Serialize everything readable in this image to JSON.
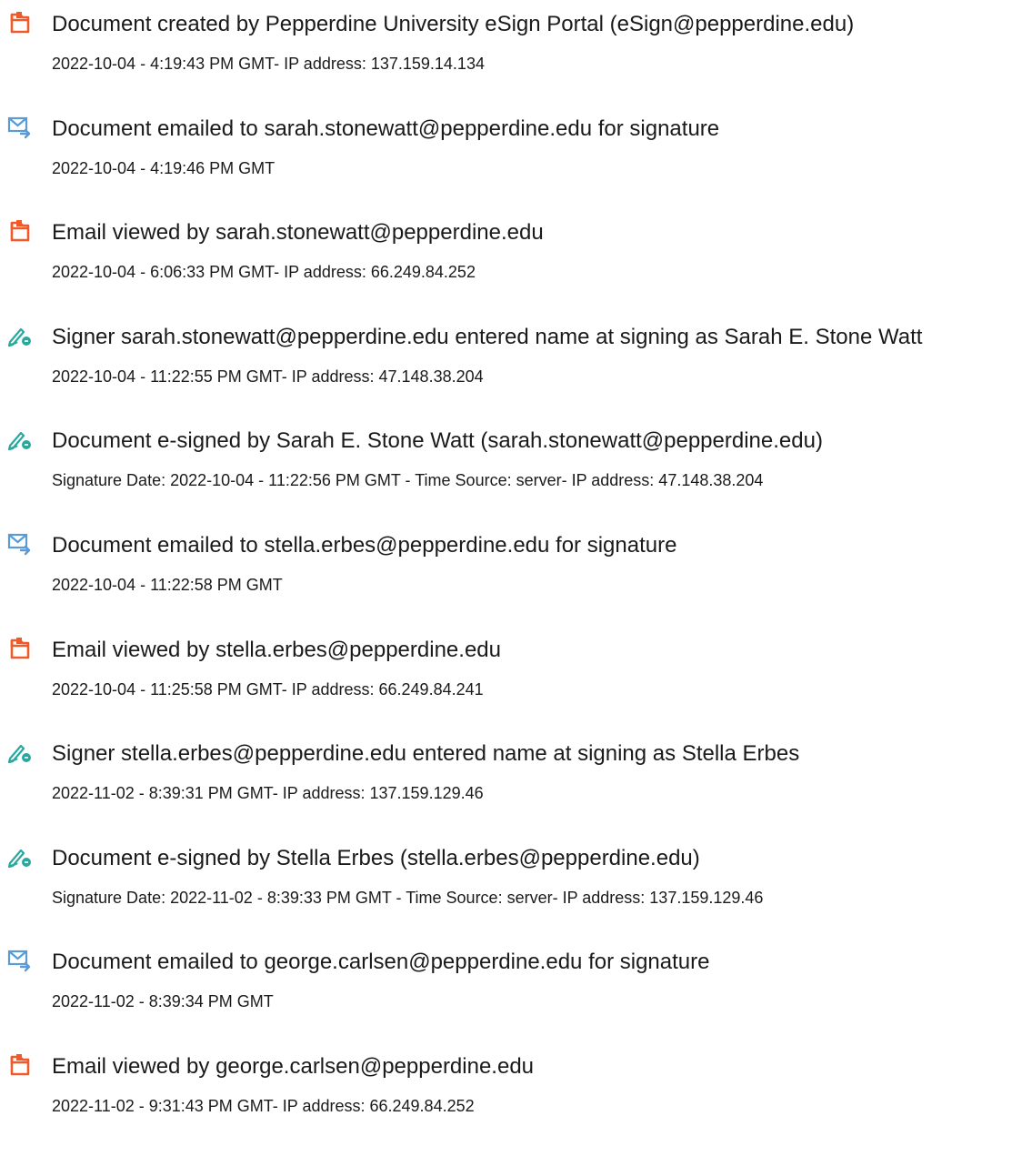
{
  "colors": {
    "created_icon": "#f05a28",
    "email_icon": "#5b9bd5",
    "sign_icon": "#2aa8a0"
  },
  "events": [
    {
      "icon": "document-created-icon",
      "title": "Document created by Pepperdine University eSign Portal (eSign@pepperdine.edu)",
      "meta": "2022-10-04 - 4:19:43 PM GMT- IP address: 137.159.14.134"
    },
    {
      "icon": "email-sent-icon",
      "title": "Document emailed to sarah.stonewatt@pepperdine.edu for signature",
      "meta": "2022-10-04 - 4:19:46 PM GMT"
    },
    {
      "icon": "document-viewed-icon",
      "title": "Email viewed by sarah.stonewatt@pepperdine.edu",
      "meta": "2022-10-04 - 6:06:33 PM GMT- IP address: 66.249.84.252"
    },
    {
      "icon": "esign-pen-icon",
      "title": "Signer sarah.stonewatt@pepperdine.edu entered name at signing as Sarah E. Stone Watt",
      "meta": "2022-10-04 - 11:22:55 PM GMT- IP address: 47.148.38.204"
    },
    {
      "icon": "esign-pen-icon",
      "title": "Document e-signed by Sarah E. Stone Watt (sarah.stonewatt@pepperdine.edu)",
      "meta": "Signature Date: 2022-10-04 - 11:22:56 PM GMT - Time Source: server- IP address: 47.148.38.204"
    },
    {
      "icon": "email-sent-icon",
      "title": "Document emailed to stella.erbes@pepperdine.edu for signature",
      "meta": "2022-10-04 - 11:22:58 PM GMT"
    },
    {
      "icon": "document-viewed-icon",
      "title": "Email viewed by stella.erbes@pepperdine.edu",
      "meta": "2022-10-04 - 11:25:58 PM GMT- IP address: 66.249.84.241"
    },
    {
      "icon": "esign-pen-icon",
      "title": "Signer stella.erbes@pepperdine.edu entered name at signing as Stella Erbes",
      "meta": "2022-11-02 - 8:39:31 PM GMT- IP address: 137.159.129.46"
    },
    {
      "icon": "esign-pen-icon",
      "title": "Document e-signed by Stella Erbes (stella.erbes@pepperdine.edu)",
      "meta": "Signature Date: 2022-11-02 - 8:39:33 PM GMT - Time Source: server- IP address: 137.159.129.46"
    },
    {
      "icon": "email-sent-icon",
      "title": "Document emailed to george.carlsen@pepperdine.edu for signature",
      "meta": "2022-11-02 - 8:39:34 PM GMT"
    },
    {
      "icon": "document-viewed-icon",
      "title": "Email viewed by george.carlsen@pepperdine.edu",
      "meta": "2022-11-02 - 9:31:43 PM GMT- IP address: 66.249.84.252"
    }
  ]
}
